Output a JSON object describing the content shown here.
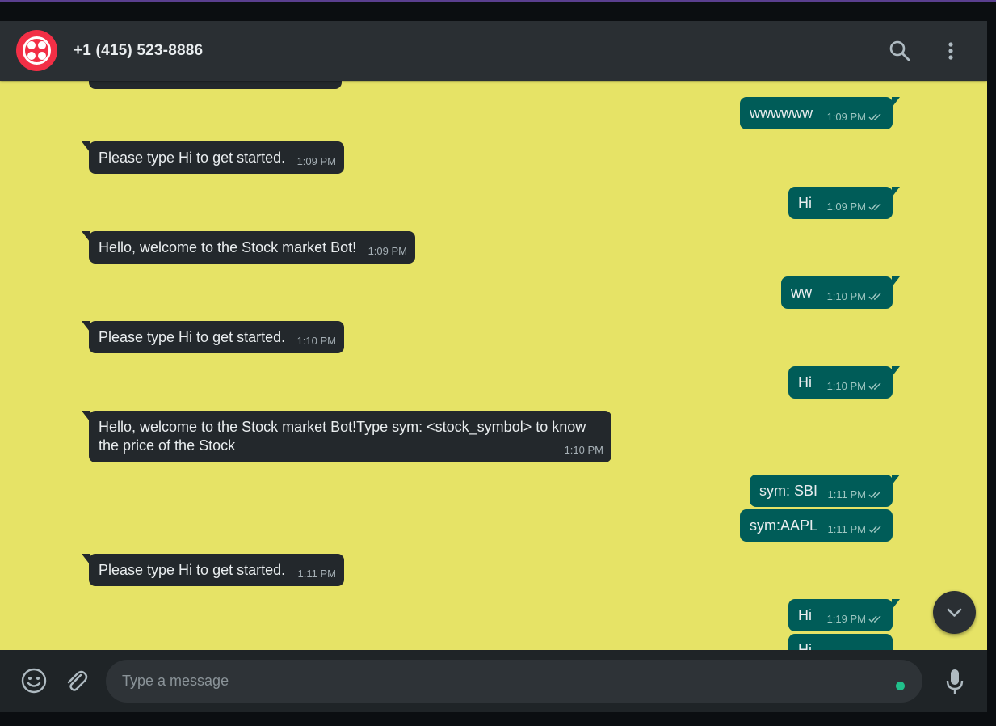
{
  "header": {
    "contact_name": "+1 (415) 523-8886",
    "avatar_icon": "twilio-logo-icon",
    "search_icon": "search-icon",
    "menu_icon": "kebab-menu-icon"
  },
  "messages": [
    {
      "direction": "out",
      "text": "wwwwww",
      "time": "1:09 PM"
    },
    {
      "direction": "in",
      "text": "Please type Hi to get started.",
      "time": "1:09 PM"
    },
    {
      "direction": "out",
      "text": "Hi",
      "time": "1:09 PM"
    },
    {
      "direction": "in",
      "text": "Hello, welcome to the Stock market Bot!",
      "time": "1:09 PM"
    },
    {
      "direction": "out",
      "text": "ww",
      "time": "1:10 PM"
    },
    {
      "direction": "in",
      "text": "Please type Hi to get started.",
      "time": "1:10 PM"
    },
    {
      "direction": "out",
      "text": "Hi",
      "time": "1:10 PM"
    },
    {
      "direction": "in",
      "text": "Hello, welcome to the Stock market Bot!Type sym: <stock_symbol> to know the price of the Stock",
      "time": "1:10 PM"
    },
    {
      "direction": "out",
      "text": "sym: SBI",
      "time": "1:11 PM"
    },
    {
      "direction": "out",
      "text": "sym:AAPL",
      "time": "1:11 PM"
    },
    {
      "direction": "in",
      "text": "Please type Hi to get started.",
      "time": "1:11 PM"
    },
    {
      "direction": "out",
      "text": "Hi",
      "time": "1:19 PM"
    },
    {
      "direction": "out",
      "text": "Hi",
      "time": ""
    }
  ],
  "composer": {
    "placeholder": "Type a message",
    "emoji_icon": "emoji-icon",
    "attach_icon": "paperclip-icon",
    "mic_icon": "microphone-icon"
  },
  "colors": {
    "chat_background": "#e6e366",
    "incoming_bubble": "#23282c",
    "outgoing_bubble": "#005c58",
    "header": "#2a2f33",
    "avatar": "#f22f46",
    "status_dot": "#21c08b"
  }
}
